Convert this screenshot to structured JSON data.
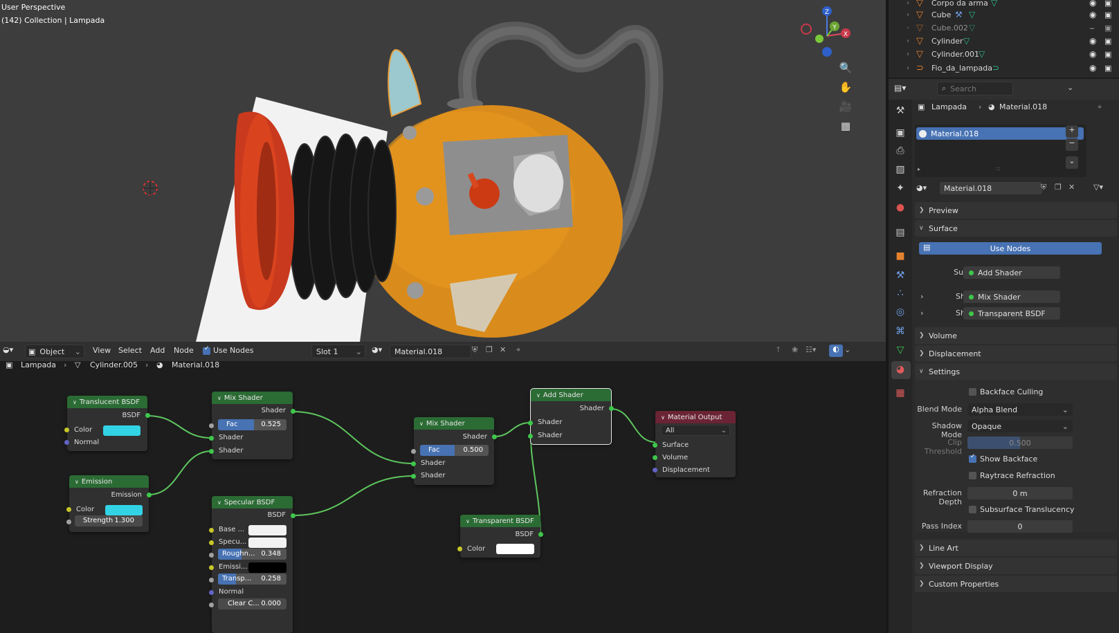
{
  "viewport": {
    "title": "User Perspective",
    "collection": "(142) Collection | Lampada",
    "gizmo": {
      "z": "Z",
      "y": "Y",
      "x": "X"
    }
  },
  "outliner": {
    "items": [
      {
        "name": "Corpo da arma"
      },
      {
        "name": "Cube"
      },
      {
        "name": "Cube.002"
      },
      {
        "name": "Cylinder"
      },
      {
        "name": "Cylinder.001"
      },
      {
        "name": "Fio_da_lampada"
      }
    ]
  },
  "properties": {
    "search_placeholder": "Search",
    "breadcrumb": {
      "object": "Lampada",
      "material": "Material.018"
    },
    "slot_list": [
      "Material.018"
    ],
    "material_name": "Material.018",
    "panels": {
      "preview": "Preview",
      "surface": "Surface",
      "volume": "Volume",
      "displacement": "Displacement",
      "settings": "Settings",
      "line_art": "Line Art",
      "viewport_display": "Viewport Display",
      "custom_properties": "Custom Properties"
    },
    "use_nodes_btn": "Use Nodes",
    "surface_label": "Surface",
    "surface_value": "Add Shader",
    "shader_label": "Shader",
    "shader1_value": "Mix Shader",
    "shader2_value": "Transparent BSDF",
    "settings": {
      "backface_culling": "Backface Culling",
      "blend_mode_label": "Blend Mode",
      "blend_mode": "Alpha Blend",
      "shadow_mode_label": "Shadow Mode",
      "shadow_mode": "Opaque",
      "clip_threshold_label": "Clip Threshold",
      "clip_threshold": "0.500",
      "show_backface": "Show Backface",
      "raytrace_refraction": "Raytrace Refraction",
      "refraction_depth_label": "Refraction Depth",
      "refraction_depth": "0 m",
      "subsurface_translucency": "Subsurface Translucency",
      "pass_index_label": "Pass Index",
      "pass_index": "0"
    }
  },
  "node_header": {
    "mode": "Object",
    "menus": [
      "View",
      "Select",
      "Add",
      "Node"
    ],
    "use_nodes": "Use Nodes",
    "slot": "Slot 1",
    "material": "Material.018"
  },
  "node_breadcrumb": {
    "object": "Lampada",
    "mesh": "Cylinder.005",
    "material": "Material.018"
  },
  "nodes": {
    "translucent": {
      "title": "Translucent BSDF",
      "out": "BSDF",
      "color": "Color",
      "normal": "Normal"
    },
    "emission": {
      "title": "Emission",
      "out": "Emission",
      "color": "Color",
      "strength_label": "Strength",
      "strength": "1.300"
    },
    "mix1": {
      "title": "Mix Shader",
      "out": "Shader",
      "fac_label": "Fac",
      "fac": "0.525",
      "in1": "Shader",
      "in2": "Shader"
    },
    "specular": {
      "title": "Specular BSDF",
      "out": "BSDF",
      "base": "Base ...",
      "spec": "Specu...",
      "rough_label": "Roughn...",
      "rough": "0.348",
      "emiss": "Emissi...",
      "transp_label": "Transp...",
      "transp": "0.258",
      "normal": "Normal",
      "clear_label": "Clear C...",
      "clear": "0.000"
    },
    "mix2": {
      "title": "Mix Shader",
      "out": "Shader",
      "fac_label": "Fac",
      "fac": "0.500",
      "in1": "Shader",
      "in2": "Shader"
    },
    "add": {
      "title": "Add Shader",
      "out": "Shader",
      "in1": "Shader",
      "in2": "Shader"
    },
    "transparent": {
      "title": "Transparent BSDF",
      "out": "BSDF",
      "color": "Color"
    },
    "output": {
      "title": "Material Output",
      "target": "All",
      "surface": "Surface",
      "volume": "Volume",
      "displacement": "Displacement"
    }
  },
  "colors": {
    "accent": "#4772b3",
    "shader_header": "#2b6b34",
    "output_header": "#6b2434",
    "cyan_swatch": "#33d3e6",
    "link": "#5ec75e"
  }
}
